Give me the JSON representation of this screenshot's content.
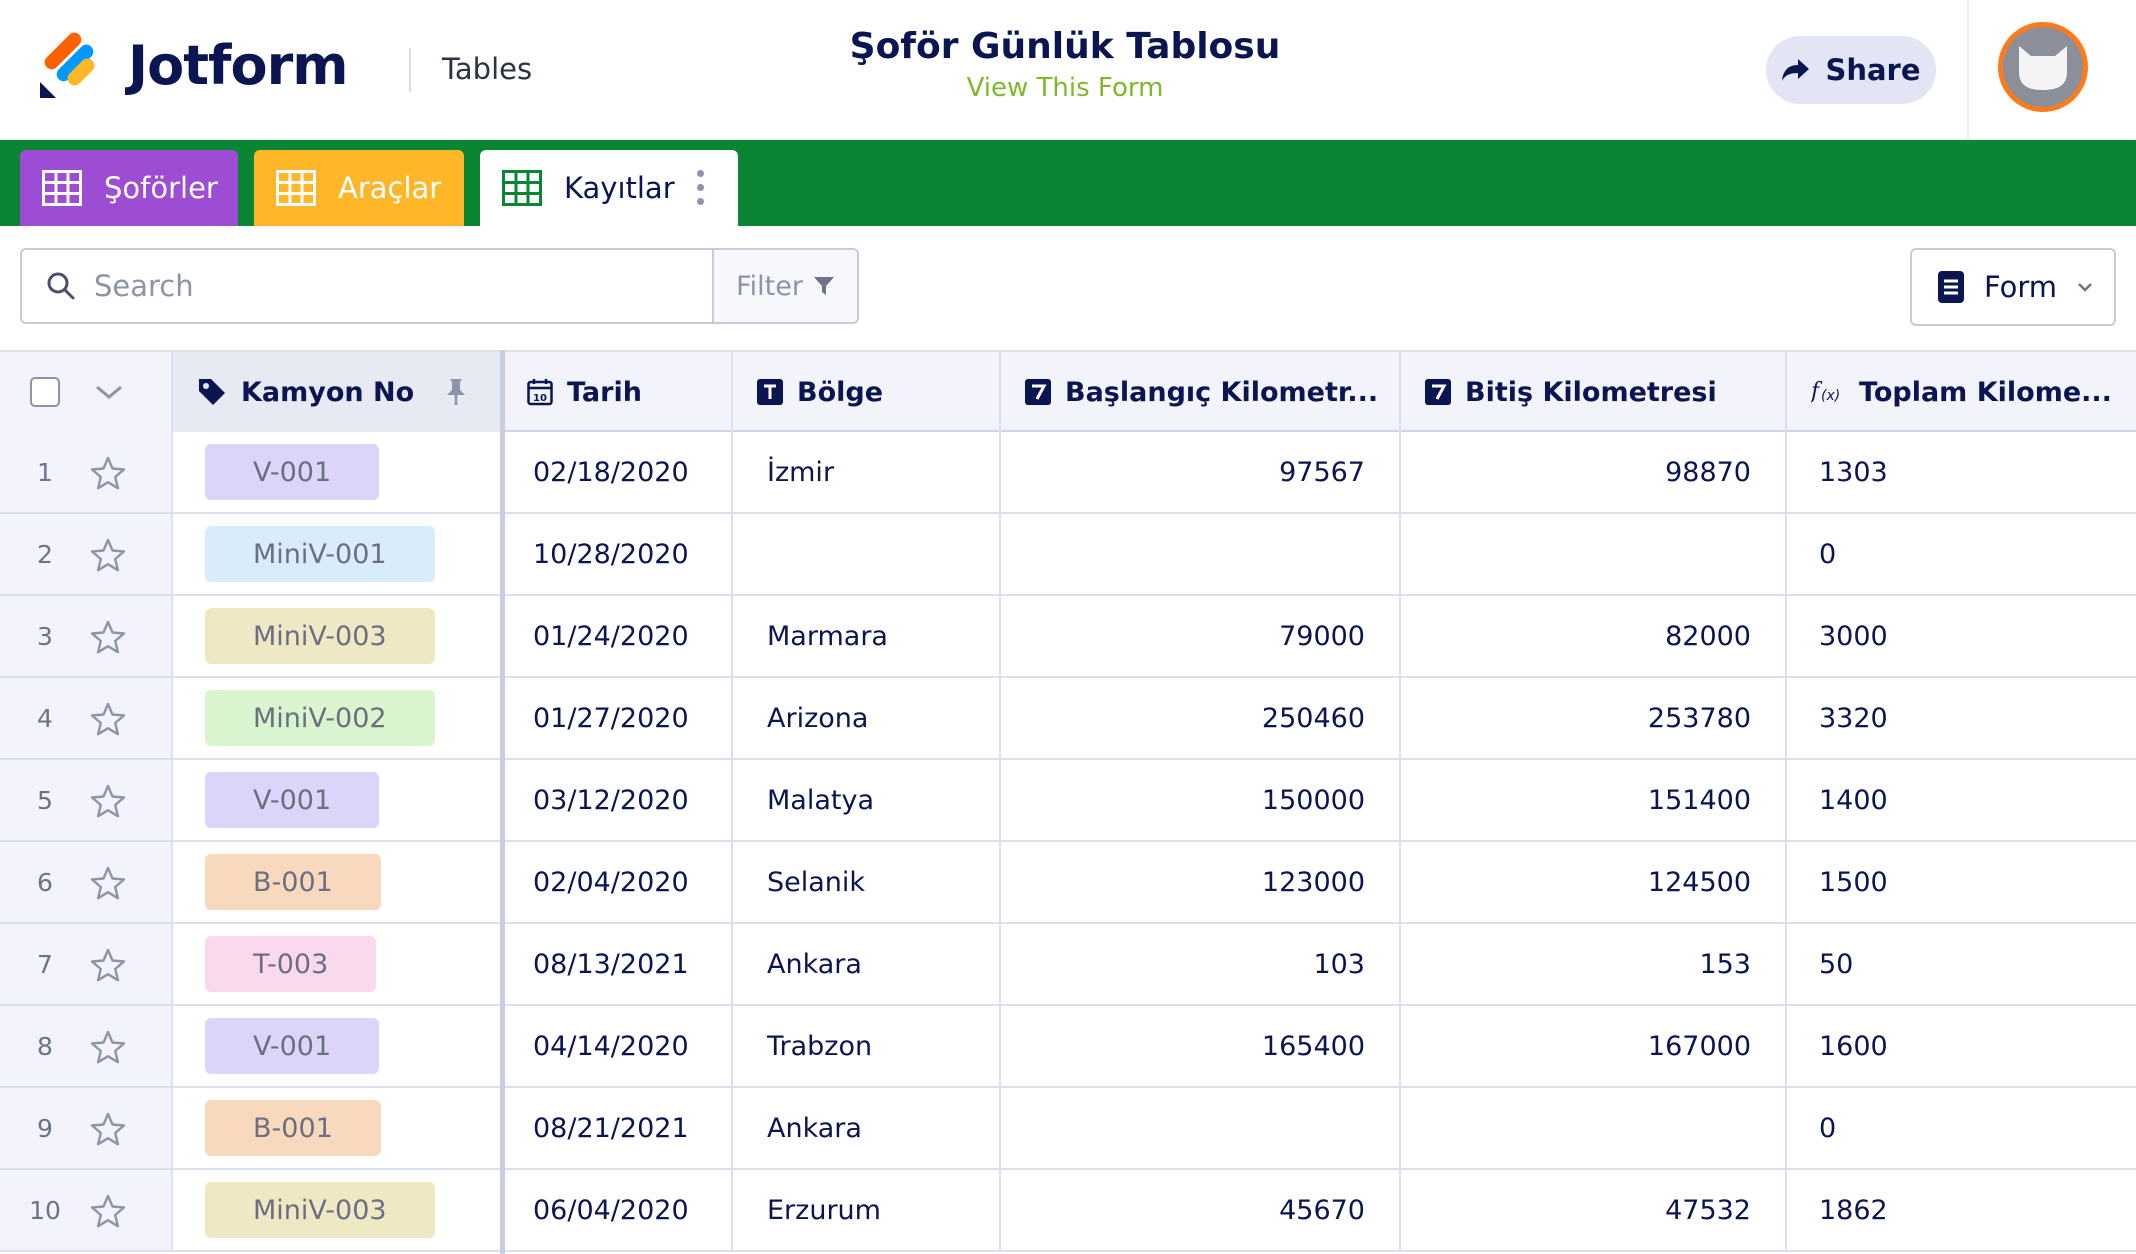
{
  "header": {
    "brand": "Jotform",
    "section": "Tables",
    "title": "Şoför Günlük Tablosu",
    "view_form_link": "View This Form",
    "share_label": "Share"
  },
  "tabs": [
    {
      "label": "Şoförler",
      "color": "#9c4dd3"
    },
    {
      "label": "Araçlar",
      "color": "#ffb629"
    },
    {
      "label": "Kayıtlar",
      "color": "#ffffff"
    }
  ],
  "toolbar": {
    "search_placeholder": "Search",
    "filter_label": "Filter",
    "form_label": "Form"
  },
  "columns": [
    {
      "label": "Kamyon No",
      "icon": "tag-icon"
    },
    {
      "label": "Tarih",
      "icon": "calendar-icon"
    },
    {
      "label": "Bölge",
      "icon": "text-type-icon"
    },
    {
      "label": "Başlangıç Kilometr...",
      "icon": "number-type-icon"
    },
    {
      "label": "Bitiş Kilometresi",
      "icon": "number-type-icon"
    },
    {
      "label": "Toplam Kilome...",
      "icon": "formula-icon"
    }
  ],
  "rows": [
    {
      "num": "1",
      "kamyon": "V-001",
      "kamyon_color": "#ddd4fa",
      "tarih": "02/18/2020",
      "bolge": "İzmir",
      "baslangic": "97567",
      "bitis": "98870",
      "toplam": "1303"
    },
    {
      "num": "2",
      "kamyon": "MiniV-001",
      "kamyon_color": "#d8ecfa",
      "tarih": "10/28/2020",
      "bolge": "",
      "baslangic": "",
      "bitis": "",
      "toplam": "0"
    },
    {
      "num": "3",
      "kamyon": "MiniV-003",
      "kamyon_color": "#efe8c4",
      "tarih": "01/24/2020",
      "bolge": "Marmara",
      "baslangic": "79000",
      "bitis": "82000",
      "toplam": "3000"
    },
    {
      "num": "4",
      "kamyon": "MiniV-002",
      "kamyon_color": "#d8f5d0",
      "tarih": "01/27/2020",
      "bolge": "Arizona",
      "baslangic": "250460",
      "bitis": "253780",
      "toplam": "3320"
    },
    {
      "num": "5",
      "kamyon": "V-001",
      "kamyon_color": "#ddd4fa",
      "tarih": "03/12/2020",
      "bolge": "Malatya",
      "baslangic": "150000",
      "bitis": "151400",
      "toplam": "1400"
    },
    {
      "num": "6",
      "kamyon": "B-001",
      "kamyon_color": "#f8d9bd",
      "tarih": "02/04/2020",
      "bolge": "Selanik",
      "baslangic": "123000",
      "bitis": "124500",
      "toplam": "1500"
    },
    {
      "num": "7",
      "kamyon": "T-003",
      "kamyon_color": "#fad9ef",
      "tarih": "08/13/2021",
      "bolge": "Ankara",
      "baslangic": "103",
      "bitis": "153",
      "toplam": "50"
    },
    {
      "num": "8",
      "kamyon": "V-001",
      "kamyon_color": "#ddd4fa",
      "tarih": "04/14/2020",
      "bolge": "Trabzon",
      "baslangic": "165400",
      "bitis": "167000",
      "toplam": "1600"
    },
    {
      "num": "9",
      "kamyon": "B-001",
      "kamyon_color": "#f8d9bd",
      "tarih": "08/21/2021",
      "bolge": "Ankara",
      "baslangic": "",
      "bitis": "",
      "toplam": "0"
    },
    {
      "num": "10",
      "kamyon": "MiniV-003",
      "kamyon_color": "#efe8c4",
      "tarih": "06/04/2020",
      "bolge": "Erzurum",
      "baslangic": "45670",
      "bitis": "47532",
      "toplam": "1862"
    }
  ]
}
